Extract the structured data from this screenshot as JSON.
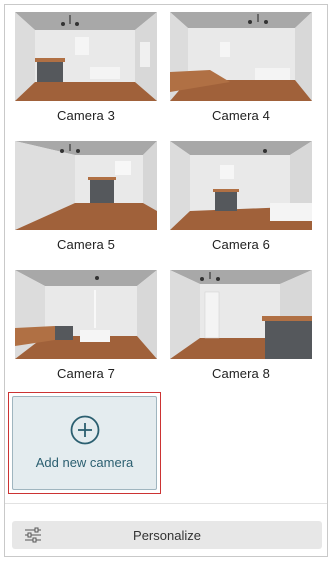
{
  "cameras": [
    {
      "label": "Camera 3"
    },
    {
      "label": "Camera 4"
    },
    {
      "label": "Camera 5"
    },
    {
      "label": "Camera 6"
    },
    {
      "label": "Camera 7"
    },
    {
      "label": "Camera 8"
    }
  ],
  "add_camera": {
    "label": "Add new camera",
    "icon": "plus-circle-icon",
    "accent": "#2b5f70"
  },
  "personalize": {
    "label": "Personalize",
    "icon": "sliders-icon"
  },
  "colors": {
    "floor": "#a0613a",
    "wall": "#e6e6e6",
    "ceiling": "#9a9a9a",
    "selection": "#cc3333"
  }
}
